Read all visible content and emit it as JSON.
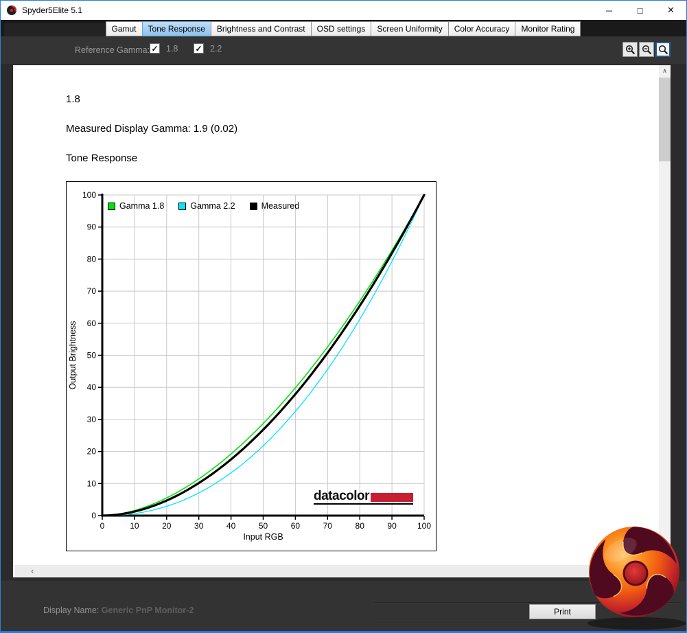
{
  "window": {
    "title": "Spyder5Elite 5.1",
    "controls": {
      "minimize_glyph": "─",
      "maximize_glyph": "□",
      "close_glyph": "✕"
    }
  },
  "tabs": {
    "items": [
      {
        "label": "Gamut",
        "active": false
      },
      {
        "label": "Tone Response",
        "active": true
      },
      {
        "label": "Brightness and Contrast",
        "active": false
      },
      {
        "label": "OSD settings",
        "active": false
      },
      {
        "label": "Screen Uniformity",
        "active": false
      },
      {
        "label": "Color Accuracy",
        "active": false
      },
      {
        "label": "Monitor Rating",
        "active": false
      }
    ]
  },
  "toolbar": {
    "reference_gamma_label": "Reference Gamma:",
    "check_glyph": "✓",
    "checkboxes": [
      {
        "label": "1.8",
        "checked": true
      },
      {
        "label": "2.2",
        "checked": true
      }
    ],
    "zoom_tools": [
      {
        "name": "zoom-in",
        "selected": false
      },
      {
        "name": "zoom-out",
        "selected": false
      },
      {
        "name": "zoom-fit",
        "selected": true
      }
    ]
  },
  "page": {
    "gamma_heading": "1.8",
    "measured_line": "Measured Display Gamma: 1.9 (0.02)",
    "section_title": "Tone Response"
  },
  "chart_data": {
    "type": "line",
    "title": "Tone Response",
    "xlabel": "Input RGB",
    "ylabel": "Output Brightness",
    "xlim": [
      0,
      100
    ],
    "ylim": [
      0,
      100
    ],
    "xticks": [
      0,
      10,
      20,
      30,
      40,
      50,
      60,
      70,
      80,
      90,
      100
    ],
    "yticks": [
      0,
      10,
      20,
      30,
      40,
      50,
      60,
      70,
      80,
      90,
      100
    ],
    "grid": true,
    "grid_color": "#c8c8c8",
    "legend_position": "top-left inside",
    "watermark": "datacolor",
    "watermark_bar_color": "#c42032",
    "series": [
      {
        "name": "Gamma 1.8",
        "color": "#00e40c",
        "width": 1.6,
        "gamma": 1.8,
        "points": [
          [
            0,
            0
          ],
          [
            10,
            1.6
          ],
          [
            20,
            5.5
          ],
          [
            30,
            11.5
          ],
          [
            40,
            19.2
          ],
          [
            50,
            28.7
          ],
          [
            60,
            39.9
          ],
          [
            70,
            52.6
          ],
          [
            80,
            66.9
          ],
          [
            90,
            82.7
          ],
          [
            100,
            100
          ]
        ]
      },
      {
        "name": "Gamma 2.2",
        "color": "#00e6ff",
        "width": 1.3,
        "gamma": 2.2,
        "points": [
          [
            0,
            0
          ],
          [
            10,
            0.6
          ],
          [
            20,
            2.9
          ],
          [
            30,
            7.1
          ],
          [
            40,
            13.3
          ],
          [
            50,
            21.8
          ],
          [
            60,
            32.5
          ],
          [
            70,
            45.6
          ],
          [
            80,
            61.2
          ],
          [
            90,
            79.3
          ],
          [
            100,
            100
          ]
        ]
      },
      {
        "name": "Measured",
        "color": "#000000",
        "width": 3.2,
        "gamma": 1.9,
        "points": [
          [
            0,
            0
          ],
          [
            10,
            1.3
          ],
          [
            20,
            4.7
          ],
          [
            30,
            10.1
          ],
          [
            40,
            17.5
          ],
          [
            50,
            26.8
          ],
          [
            60,
            37.9
          ],
          [
            70,
            50.8
          ],
          [
            80,
            65.5
          ],
          [
            90,
            81.9
          ],
          [
            100,
            100
          ]
        ]
      }
    ]
  },
  "scrollbars": {
    "up_glyph": "∧",
    "left_glyph": "‹"
  },
  "footer": {
    "display_name_label": "Display Name:",
    "display_name_value": "Generic PnP Monitor-2",
    "print_button": "Print"
  },
  "colors": {
    "window_border": "#2a80d8",
    "active_tab": "#8cc2ee",
    "chrome_dark": "#333333"
  }
}
